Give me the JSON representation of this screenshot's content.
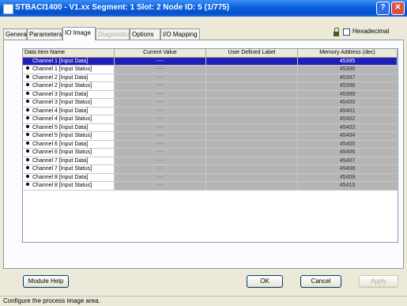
{
  "window": {
    "title": "STBACI1400 - V1.xx Segment: 1 Slot: 2 Node ID: 5 (1/775)"
  },
  "tabs": [
    {
      "label": "General",
      "state": "normal"
    },
    {
      "label": "Parameters",
      "state": "normal"
    },
    {
      "label": "IO Image",
      "state": "active"
    },
    {
      "label": "Diagnostics",
      "state": "disabled"
    },
    {
      "label": "Options",
      "state": "normal"
    },
    {
      "label": "I/O Mapping",
      "state": "normal"
    }
  ],
  "hexadecimal": {
    "label": "Hexadecimal",
    "checked": false,
    "icon": "lock-icon"
  },
  "grid": {
    "columns": [
      "Data Item Name",
      "Current Value",
      "User Defined Label",
      "Memory Address (dec)"
    ],
    "rows": [
      {
        "name": "Channel 1 [Input Data]",
        "value": "----",
        "label": "",
        "address": "45395",
        "bullet": false,
        "selected": true
      },
      {
        "name": "Channel 1 [Input Status]",
        "value": "----",
        "label": "",
        "address": "45396",
        "bullet": true,
        "selected": false
      },
      {
        "name": "Channel 2 [Input Data]",
        "value": "----",
        "label": "",
        "address": "45397",
        "bullet": true,
        "selected": false
      },
      {
        "name": "Channel 2 [Input Status]",
        "value": "----",
        "label": "",
        "address": "45398",
        "bullet": true,
        "selected": false
      },
      {
        "name": "Channel 3 [Input Data]",
        "value": "----",
        "label": "",
        "address": "45399",
        "bullet": true,
        "selected": false
      },
      {
        "name": "Channel 3 [Input Status]",
        "value": "----",
        "label": "",
        "address": "45400",
        "bullet": true,
        "selected": false
      },
      {
        "name": "Channel 4 [Input Data]",
        "value": "----",
        "label": "",
        "address": "45401",
        "bullet": true,
        "selected": false
      },
      {
        "name": "Channel 4 [Input Status]",
        "value": "----",
        "label": "",
        "address": "45402",
        "bullet": true,
        "selected": false
      },
      {
        "name": "Channel 5 [Input Data]",
        "value": "----",
        "label": "",
        "address": "45403",
        "bullet": true,
        "selected": false
      },
      {
        "name": "Channel 5 [Input Status]",
        "value": "----",
        "label": "",
        "address": "45404",
        "bullet": true,
        "selected": false
      },
      {
        "name": "Channel 6 [Input Data]",
        "value": "----",
        "label": "",
        "address": "45405",
        "bullet": true,
        "selected": false
      },
      {
        "name": "Channel 6 [Input Status]",
        "value": "----",
        "label": "",
        "address": "45406",
        "bullet": true,
        "selected": false
      },
      {
        "name": "Channel 7 [Input Data]",
        "value": "----",
        "label": "",
        "address": "45407",
        "bullet": true,
        "selected": false
      },
      {
        "name": "Channel 7 [Input Status]",
        "value": "----",
        "label": "",
        "address": "45408",
        "bullet": true,
        "selected": false
      },
      {
        "name": "Channel 8 [Input Data]",
        "value": "----",
        "label": "",
        "address": "45409",
        "bullet": true,
        "selected": false
      },
      {
        "name": "Channel 8 [Input Status]",
        "value": "----",
        "label": "",
        "address": "45410",
        "bullet": true,
        "selected": false
      }
    ]
  },
  "buttons": {
    "module_help": "Module Help",
    "ok": "OK",
    "cancel": "Cancel",
    "apply": "Apply"
  },
  "status_text": "Configure the process image area.",
  "colors": {
    "title_bar": "#0a5fe0",
    "selection": "#2020b8",
    "cell_gray": "#b5b5b5",
    "dialog_bg": "#ece9d8"
  }
}
